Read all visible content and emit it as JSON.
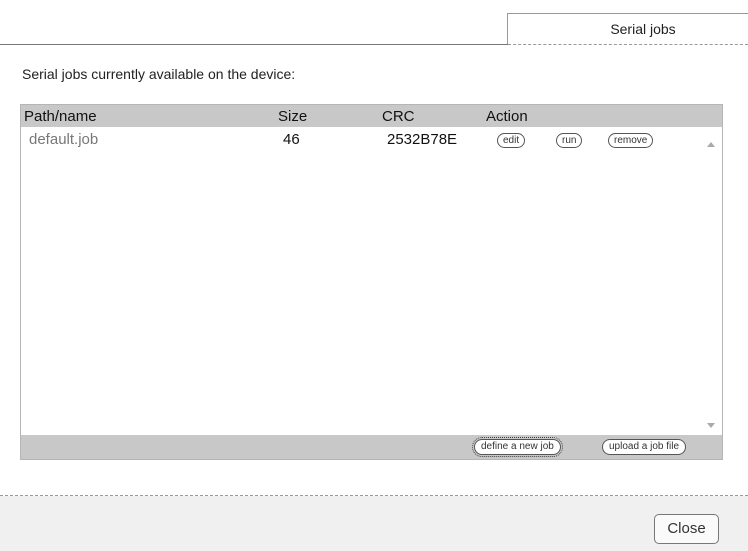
{
  "tab": {
    "label": "Serial jobs"
  },
  "intro_text": "Serial jobs currently available on the device:",
  "table": {
    "columns": [
      "Path/name",
      "Size",
      "CRC",
      "Action"
    ],
    "rows": [
      {
        "name": "default.job",
        "size": "46",
        "crc": "2532B78E",
        "actions": [
          "edit",
          "run",
          "remove"
        ]
      }
    ]
  },
  "footer_buttons": {
    "define": "define a new job",
    "upload": "upload a job file"
  },
  "close_label": "Close"
}
